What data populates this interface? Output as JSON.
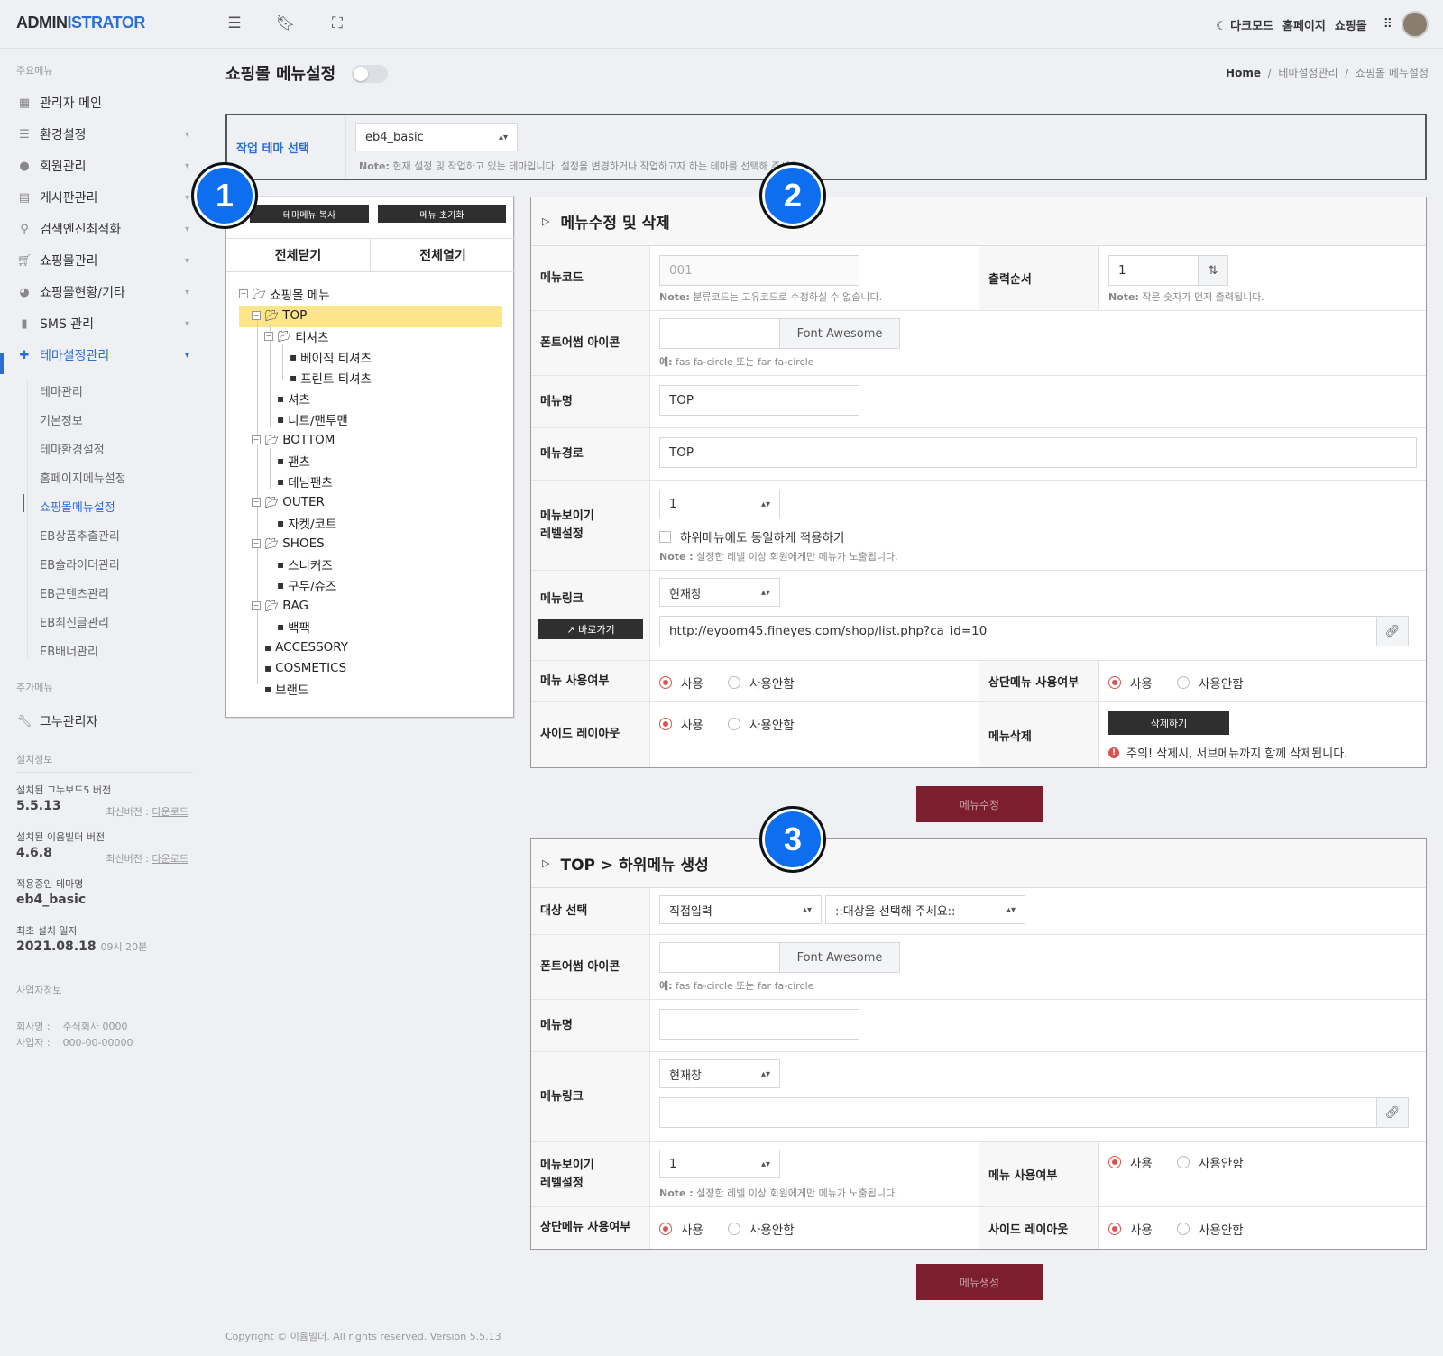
{
  "header": {
    "logo_a": "ADMIN",
    "logo_b": "ISTRATOR",
    "dark_mode": "다크모드",
    "homepage": "홈페이지",
    "shop": "쇼핑몰"
  },
  "sidebar": {
    "section_main": "주요메뉴",
    "items": [
      "관리자 메인",
      "환경설정",
      "회원관리",
      "게시판관리",
      "검색엔진최적화",
      "쇼핑몰관리",
      "쇼핑몰현황/기타",
      "SMS 관리",
      "테마설정관리"
    ],
    "subitems": [
      "테마관리",
      "기본정보",
      "테마환경설정",
      "홈페이지메뉴설정",
      "쇼핑몰메뉴설정",
      "EB상품추출관리",
      "EB슬라이더관리",
      "EB콘텐츠관리",
      "EB최신글관리",
      "EB배너관리"
    ],
    "section_extra": "추가메뉴",
    "extra_item": "그누관리자",
    "section_install": "설치정보",
    "gnu_label": "설치된 그누보드5 버전",
    "gnu_ver": "5.5.13",
    "gnu_latest": "최신버전 : ",
    "download": "다운로드",
    "eyoom_label": "설치된 이윰빌더 버전",
    "eyoom_ver": "4.6.8",
    "eyoom_latest": "최신버전 : ",
    "theme_label": "적용중인 테마명",
    "theme_val": "eb4_basic",
    "date_label": "최초 설치 일자",
    "date_val": "2021.08.18",
    "time_val": "09시 20분",
    "section_biz": "사업자정보",
    "company_k": "회사명 :",
    "company_v": "주식회사 0000",
    "bizno_k": "사업자 :",
    "bizno_v": "000-00-00000"
  },
  "page": {
    "title": "쇼핑몰 메뉴설정",
    "crumb_home": "Home",
    "crumb_1": "테마설정관리",
    "crumb_2": "쇼핑몰 메뉴설정",
    "sep": "/"
  },
  "theme_select": {
    "label": "작업 테마 선택",
    "value": "eb4_basic",
    "note_b": "Note:",
    "note": "현재 설정 및 작업하고 있는 테마입니다. 설정을 변경하거나 작업하고자 하는 테마를 선택해 주세요."
  },
  "tree": {
    "copy_btn": "테마메뉴 복사",
    "reset_btn": "메뉴 초기화",
    "collapse": "전체닫기",
    "expand": "전체열기",
    "root": "쇼핑몰 메뉴",
    "top": "TOP",
    "tshirt": "티셔츠",
    "basic_tee": "베이직 티셔츠",
    "print_tee": "프린트 티셔츠",
    "shirt": "셔츠",
    "knit": "니트/맨투맨",
    "bottom": "BOTTOM",
    "pants": "팬츠",
    "denim": "데님팬츠",
    "outer": "OUTER",
    "jacket": "자켓/코트",
    "shoes": "SHOES",
    "sneakers": "스니커즈",
    "dress_shoes": "구두/슈즈",
    "bag": "BAG",
    "backpack": "백팩",
    "accessory": "ACCESSORY",
    "cosmetics": "COSMETICS",
    "brand": "브랜드"
  },
  "edit": {
    "title": "메뉴수정 및 삭제",
    "code_label": "메뉴코드",
    "code_value": "001",
    "code_note_b": "Note:",
    "code_note": "분류코드는 고유코드로 수정하실 수 없습니다.",
    "order_label": "출력순서",
    "order_value": "1",
    "order_note_b": "Note:",
    "order_note": "작은 숫자가 먼저 출력됩니다.",
    "icon_label": "폰트어썸 아이콘",
    "fa_btn": "Font Awesome",
    "icon_note_b": "예:",
    "icon_note": "fas fa-circle 또는 far fa-circle",
    "name_label": "메뉴명",
    "name_value": "TOP",
    "path_label": "메뉴경로",
    "path_value": "TOP",
    "level_label_1": "메뉴보이기",
    "level_label_2": "레벨설정",
    "level_value": "1",
    "level_check": "하위메뉴에도 동일하게 적용하기",
    "level_note_b": "Note :",
    "level_note": "설정한 레벨 이상 회원에게만 메뉴가 노출됩니다.",
    "link_label": "메뉴링크",
    "goto_btn": "바로가기",
    "link_target": "현재창",
    "link_url": "http://eyoom45.fineyes.com/shop/list.php?ca_id=10",
    "use_label": "메뉴 사용여부",
    "top_use_label": "상단메뉴 사용여부",
    "side_label": "사이드 레이아웃",
    "delete_label": "메뉴삭제",
    "yes": "사용",
    "no": "사용안함",
    "delete_btn": "삭제하기",
    "delete_warn": "주의! 삭제시, 서브메뉴까지 함께 삭제됩니다.",
    "submit": "메뉴수정"
  },
  "create": {
    "title": "TOP > 하위메뉴 생성",
    "target_label": "대상 선택",
    "target_sel1": "직접입력",
    "target_sel2": "::대상을 선택해 주세요::",
    "icon_label": "폰트어썸 아이콘",
    "fa_btn": "Font Awesome",
    "icon_note_b": "예:",
    "icon_note": "fas fa-circle 또는 far fa-circle",
    "name_label": "메뉴명",
    "link_label": "메뉴링크",
    "link_target": "현재창",
    "level_label_1": "메뉴보이기",
    "level_label_2": "레벨설정",
    "level_value": "1",
    "level_note_b": "Note :",
    "level_note": "설정한 레벨 이상 회원에게만 메뉴가 노출됩니다.",
    "use_label": "메뉴 사용여부",
    "top_use_label": "상단메뉴 사용여부",
    "side_label": "사이드 레이아웃",
    "yes": "사용",
    "no": "사용안함",
    "submit": "메뉴생성"
  },
  "badges": [
    "1",
    "2",
    "3"
  ],
  "footer": "Copyright © 이윰빌더. All rights reserved. Version 5.5.13",
  "colors": {
    "accent": "#2b6fd6",
    "badge": "#0d6ff0",
    "highlight": "#ffe58a",
    "submit": "#7b1f2f",
    "radio_on": "#d9534f"
  }
}
